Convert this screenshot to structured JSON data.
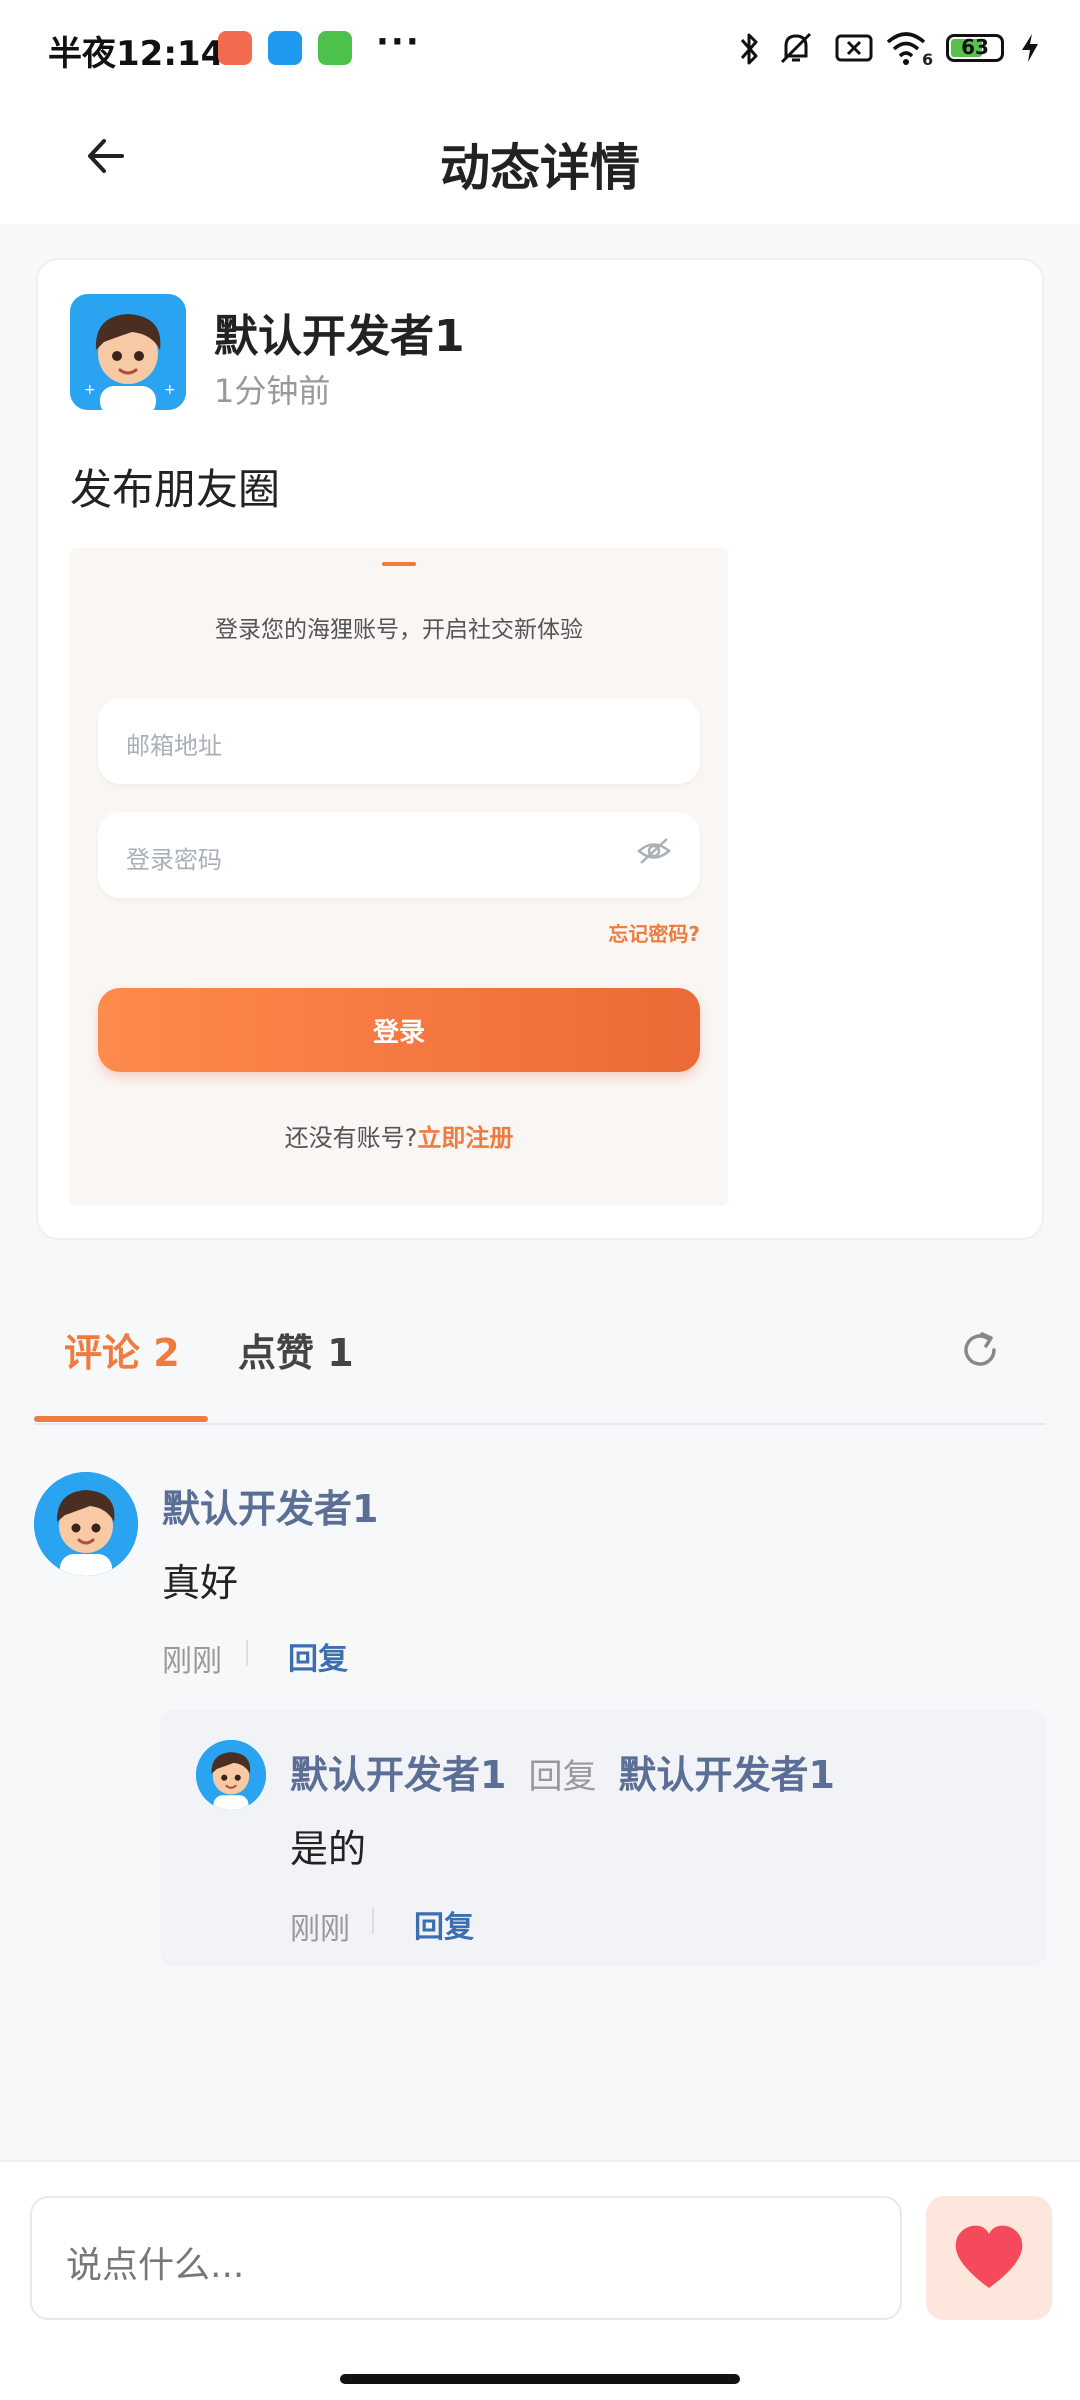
{
  "status_bar": {
    "time": "半夜12:14",
    "more": "···",
    "battery": "63",
    "wifi_sub": "6"
  },
  "header": {
    "title": "动态详情"
  },
  "post": {
    "author": "默认开发者1",
    "time": "1分钟前",
    "text": "发布朋友圈",
    "image": {
      "subtitle": "登录您的海狸账号，开启社交新体验",
      "email_placeholder": "邮箱地址",
      "password_placeholder": "登录密码",
      "forgot": "忘记密码?",
      "login_button": "登录",
      "register_prompt": "还没有账号?",
      "register_link": "立即注册"
    }
  },
  "tabs": {
    "comments": "评论 2",
    "likes": "点赞 1"
  },
  "comments": [
    {
      "author": "默认开发者1",
      "text": "真好",
      "time": "刚刚",
      "reply_label": "回复",
      "replies": [
        {
          "author": "默认开发者1",
          "reply_word": "回复",
          "target": "默认开发者1",
          "text": "是的",
          "time": "刚刚",
          "reply_label": "回复"
        }
      ]
    }
  ],
  "bottom_bar": {
    "placeholder": "说点什么..."
  },
  "colors": {
    "accent": "#f07b3f",
    "name": "#5b6f96",
    "link": "#3d6fb0",
    "like_bg": "#fde6dc",
    "heart": "#f54a5c"
  }
}
